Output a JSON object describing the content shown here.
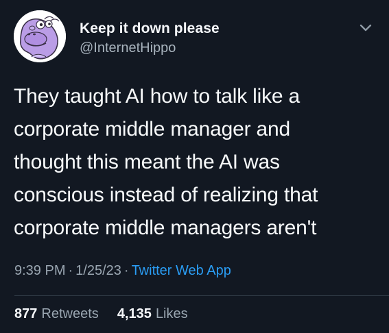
{
  "tweet": {
    "author": {
      "display_name": "Keep it down please",
      "handle": "@InternetHippo",
      "avatar_icon": "hippo-avatar-icon"
    },
    "menu_icon": "chevron-down-icon",
    "text_lines": [
      "They taught AI how to talk like a",
      "corporate middle manager and",
      "thought this meant the AI was",
      "conscious instead of realizing that",
      "corporate middle managers aren't"
    ],
    "meta": {
      "time": "9:39 PM",
      "separator": "·",
      "date": "1/25/23",
      "source": "Twitter Web App"
    },
    "stats": {
      "retweets_count": "877",
      "retweets_label": "Retweets",
      "likes_count": "4,135",
      "likes_label": "Likes"
    }
  },
  "colors": {
    "background": "#121822",
    "primary_text": "#f7f9fa",
    "secondary_text": "#9aa6b1",
    "link": "#2a9df4",
    "avatar_hippo": "#ba9de6"
  }
}
